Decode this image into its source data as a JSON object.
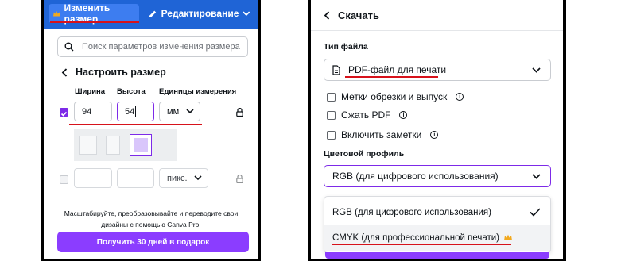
{
  "left_panel": {
    "toolbar": {
      "resize_label": "Изменить размер",
      "edit_label": "Редактирование"
    },
    "search": {
      "placeholder": "Поиск параметров изменения размера"
    },
    "custom_size": {
      "title": "Настроить размер",
      "columns": {
        "width": "Ширина",
        "height": "Высота",
        "units": "Единицы измерения"
      },
      "row1": {
        "width": "94",
        "height": "54",
        "units": "мм",
        "checked": true
      },
      "row2": {
        "width": "",
        "height": "",
        "units": "пикс.",
        "checked": false
      }
    },
    "promo": {
      "text_line1": "Масштабируйте, преобразовывайте и переводите свои",
      "text_line2": "дизайны с помощью Canva Pro.",
      "button_label": "Получить 30 дней в подарок"
    }
  },
  "right_panel": {
    "header": {
      "title": "Скачать"
    },
    "file_type": {
      "label": "Тип файла",
      "selected": "PDF-файл для печати"
    },
    "options": [
      {
        "label": "Метки обрезки и выпуск",
        "info": true
      },
      {
        "label": "Сжать PDF",
        "info": true
      },
      {
        "label": "Включить заметки",
        "info": true
      }
    ],
    "color_profile": {
      "label": "Цветовой профиль",
      "selected": "RGB (для цифрового использования)",
      "options": [
        {
          "label": "RGB (для цифрового использования)",
          "checked": true
        },
        {
          "label": "CMYK (для профессиональной печати)",
          "pro": true
        }
      ]
    }
  },
  "colors": {
    "brand_blue": "#1f64d6",
    "canva_purple": "#8b3dff",
    "highlight_red": "#d7121b",
    "pro_crown": "#f2a91f"
  }
}
